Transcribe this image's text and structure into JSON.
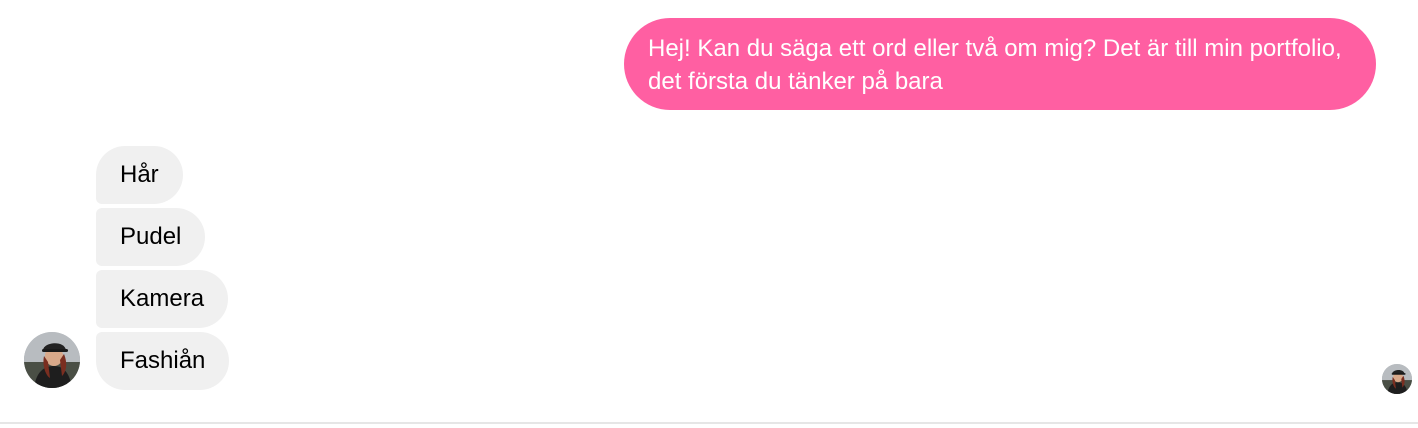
{
  "conversation": {
    "outgoing": {
      "text": "Hej! Kan du säga ett ord eller två om mig? Det är till min portfolio, det första du tänker på bara"
    },
    "incoming": [
      {
        "text": "Hår"
      },
      {
        "text": "Pudel"
      },
      {
        "text": "Kamera"
      },
      {
        "text": "Fashiån"
      }
    ]
  },
  "colors": {
    "outgoing_bubble": "#ff5fa2",
    "incoming_bubble": "#f0f0f0"
  },
  "icons": {
    "sender_avatar": "contact-avatar-icon",
    "read_receipt": "seen-avatar-icon"
  }
}
